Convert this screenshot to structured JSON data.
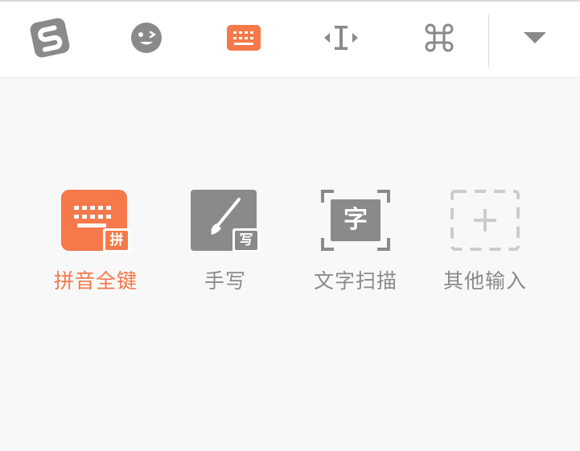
{
  "colors": {
    "accent": "#f5794a",
    "icon_gray": "#8a8a8a",
    "placeholder_gray": "#cccccc",
    "panel_bg": "#f8f8f8"
  },
  "toolbar": {
    "items": [
      {
        "name": "sogou-logo",
        "icon": "sogou-s-logo"
      },
      {
        "name": "emoji",
        "icon": "winking-face-icon"
      },
      {
        "name": "keyboard-switch",
        "icon": "keyboard-icon",
        "active": true
      },
      {
        "name": "cursor-move",
        "icon": "text-cursor-arrows-icon"
      },
      {
        "name": "command",
        "icon": "command-key-icon"
      },
      {
        "name": "collapse",
        "icon": "triangle-down-icon"
      }
    ]
  },
  "modes": [
    {
      "label": "拼音全键",
      "badge": "拼",
      "icon": "keyboard-pinyin-icon",
      "selected": true
    },
    {
      "label": "手写",
      "badge": "写",
      "icon": "brush-handwriting-icon",
      "selected": false
    },
    {
      "label": "文字扫描",
      "badge": "字",
      "icon": "text-scan-icon",
      "selected": false
    },
    {
      "label": "其他输入",
      "icon": "add-dashed-icon",
      "selected": false
    }
  ]
}
